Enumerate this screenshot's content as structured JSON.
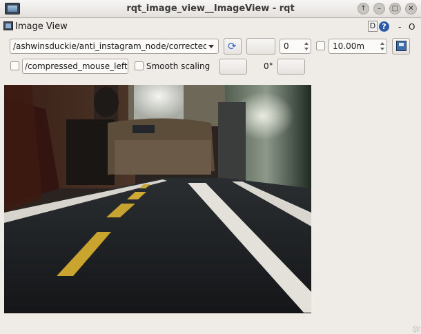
{
  "window": {
    "title": "rqt_image_view__ImageView - rqt"
  },
  "title_buttons": {
    "help": "?",
    "minimize": "–",
    "maximize": "□",
    "close": "✕"
  },
  "panel": {
    "title": "Image View",
    "d_label": "D",
    "help_label": "?",
    "dash_label": "-",
    "o_label": "O"
  },
  "toolbar": {
    "topic": "/ashwinsduckie/anti_instagram_node/corrected_image",
    "spin_value": "0",
    "max_range": "10.00m"
  },
  "options": {
    "mouse_topic": "/compressed_mouse_left",
    "smooth_label": "Smooth scaling",
    "rotation": "0°"
  }
}
